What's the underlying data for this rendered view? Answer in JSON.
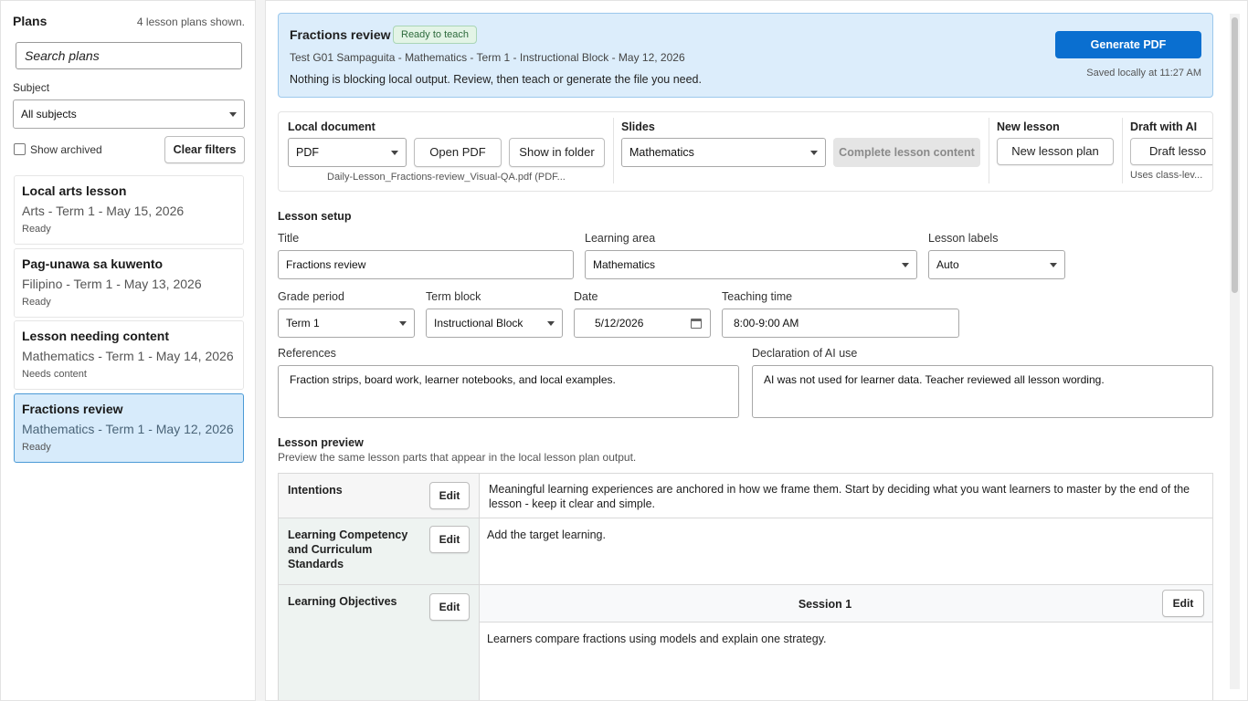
{
  "sidebar": {
    "title": "Plans",
    "count": "4 lesson plans shown.",
    "search_placeholder": "Search plans",
    "subject_label": "Subject",
    "subject_value": "All subjects",
    "show_archived": "Show archived",
    "clear_filters": "Clear filters",
    "plans": [
      {
        "title": "Local arts lesson",
        "meta": "Arts - Term 1 - May 15, 2026",
        "status": "Ready"
      },
      {
        "title": "Pag-unawa sa kuwento",
        "meta": "Filipino - Term 1 - May 13, 2026",
        "status": "Ready"
      },
      {
        "title": "Lesson needing content",
        "meta": "Mathematics - Term 1 - May 14, 2026",
        "status": "Needs content"
      },
      {
        "title": "Fractions review",
        "meta": "Mathematics - Term 1 - May 12, 2026",
        "status": "Ready",
        "selected": true
      }
    ]
  },
  "banner": {
    "title": "Fractions review",
    "badge": "Ready to teach",
    "meta": "Test G01 Sampaguita - Mathematics - Term 1 - Instructional Block - May 12, 2026",
    "note": "Nothing is blocking local output. Review, then teach or generate the file you need.",
    "generate": "Generate PDF",
    "saved": "Saved locally at 11:27 AM"
  },
  "toolbar": {
    "local_document_label": "Local document",
    "format_value": "PDF",
    "open_pdf": "Open PDF",
    "show_in_folder": "Show in folder",
    "filename": "Daily-Lesson_Fractions-review_Visual-QA.pdf (PDF...",
    "slides_label": "Slides",
    "slides_value": "Mathematics",
    "complete_content": "Complete lesson content",
    "new_lesson_label": "New lesson",
    "new_lesson_plan": "New lesson plan",
    "draft_ai_label": "Draft with AI",
    "draft_button": "Draft lesso",
    "draft_note": "Uses class-lev..."
  },
  "setup": {
    "heading": "Lesson setup",
    "title_label": "Title",
    "title_value": "Fractions review",
    "area_label": "Learning area",
    "area_value": "Mathematics",
    "labels_label": "Lesson labels",
    "labels_value": "Auto",
    "grade_label": "Grade period",
    "grade_value": "Term 1",
    "term_label": "Term block",
    "term_value": "Instructional Block",
    "date_label": "Date",
    "date_value": "5/12/2026",
    "time_label": "Teaching time",
    "time_value": "8:00-9:00 AM",
    "refs_label": "References",
    "refs_value": "Fraction strips, board work, learner notebooks, and local examples.",
    "ai_label": "Declaration of AI use",
    "ai_value": "AI was not used for learner data. Teacher reviewed all lesson wording."
  },
  "preview": {
    "heading": "Lesson preview",
    "subheading": "Preview the same lesson parts that appear in the local lesson plan output.",
    "edit": "Edit",
    "intentions_name": "Intentions",
    "intentions_text": "Meaningful learning experiences are anchored in how we frame them. Start by deciding what you want learners to master by the end of the lesson - keep it clear and simple.",
    "competency_name": "Learning Competency and Curriculum Standards",
    "competency_text": "Add the target learning.",
    "objectives_name": "Learning Objectives",
    "session": "Session 1",
    "objectives_text": "Learners compare fractions using models and explain one strategy."
  }
}
